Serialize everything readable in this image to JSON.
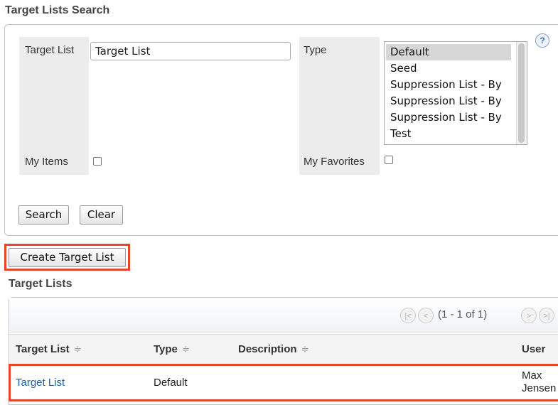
{
  "search": {
    "title": "Target Lists Search",
    "target_list_label": "Target List",
    "target_list_value": "Target List",
    "type_label": "Type",
    "type_options": [
      {
        "label": "Default",
        "selected": true
      },
      {
        "label": "Seed",
        "selected": false
      },
      {
        "label": "Suppression List - By",
        "selected": false
      },
      {
        "label": "Suppression List - By",
        "selected": false
      },
      {
        "label": "Suppression List - By",
        "selected": false
      },
      {
        "label": "Test",
        "selected": false
      }
    ],
    "my_items_label": "My Items",
    "my_favorites_label": "My Favorites",
    "help_icon_text": "?",
    "search_button": "Search",
    "clear_button": "Clear"
  },
  "create_button": "Create Target List",
  "list": {
    "title": "Target Lists",
    "pagination": "(1 - 1 of 1)",
    "columns": [
      "Target List",
      "Type",
      "Description",
      "User"
    ],
    "sort_icon": "≑",
    "rows": [
      {
        "target_list": "Target List",
        "type": "Default",
        "description": "",
        "user_line1": "Max",
        "user_line2": "Jensen"
      }
    ]
  },
  "colors": {
    "highlight": "#e8452c",
    "link": "#1a5fa6"
  },
  "icons": [
    "help-icon",
    "first-page-icon",
    "prev-page-icon",
    "next-page-icon",
    "last-page-icon",
    "sort-icon"
  ]
}
